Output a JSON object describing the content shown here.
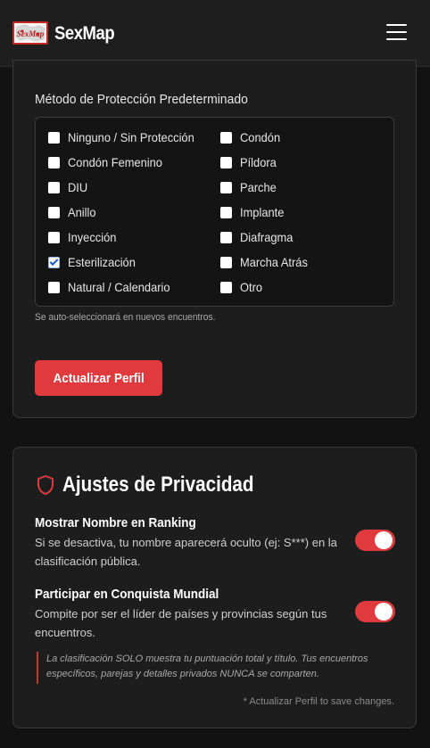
{
  "header": {
    "logo_text": "SexMap",
    "brand": "SexMap",
    "menu_icon": "hamburger-menu-icon"
  },
  "protection": {
    "label": "Método de Protección Predeterminado",
    "options": [
      {
        "label": "Ninguno / Sin Protección",
        "checked": false
      },
      {
        "label": "Condón",
        "checked": false
      },
      {
        "label": "Condón Femenino",
        "checked": false
      },
      {
        "label": "Píldora",
        "checked": false
      },
      {
        "label": "DIU",
        "checked": false
      },
      {
        "label": "Parche",
        "checked": false
      },
      {
        "label": "Anillo",
        "checked": false
      },
      {
        "label": "Implante",
        "checked": false
      },
      {
        "label": "Inyección",
        "checked": false
      },
      {
        "label": "Diafragma",
        "checked": false
      },
      {
        "label": "Esterilización",
        "checked": true
      },
      {
        "label": "Marcha Atrás",
        "checked": false
      },
      {
        "label": "Natural / Calendario",
        "checked": false
      },
      {
        "label": "Otro",
        "checked": false
      }
    ],
    "hint": "Se auto-seleccionará en nuevos encuentros.",
    "update_button": "Actualizar Perfil"
  },
  "privacy": {
    "icon": "shield-icon",
    "title": "Ajustes de Privacidad",
    "settings": [
      {
        "title": "Mostrar Nombre en Ranking",
        "description": "Si se desactiva, tu nombre aparecerá oculto (ej: S***) en la clasificación pública.",
        "enabled": true
      },
      {
        "title": "Participar en Conquista Mundial",
        "description": "Compite por ser el líder de países y provincias según tus encuentros.",
        "enabled": true
      }
    ],
    "notice": "La clasificación SOLO muestra tu puntuación total y título. Tus encuentros específicos, parejas y detalles privados NUNCA se comparten.",
    "save_note": "* Actualizar Perfil to save changes."
  },
  "colors": {
    "accent": "#e03a3e",
    "background": "#121212",
    "card": "#1d1d1d"
  }
}
